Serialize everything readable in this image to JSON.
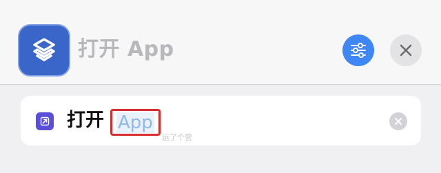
{
  "header": {
    "title": "打开 App",
    "app_icon": "shortcuts-layers-icon",
    "settings_icon": "sliders-icon",
    "close_icon": "close-icon"
  },
  "action": {
    "verb": "打开",
    "parameter_placeholder": "App",
    "action_icon": "open-app-arrow-icon",
    "clear_icon": "clear-x-icon"
  },
  "watermark": "运了个营",
  "colors": {
    "accent_blue": "#3f87f5",
    "app_icon_bg": "#3b66c9",
    "action_icon_bg": "#5a4fd6",
    "highlight_box": "#d62e2e",
    "placeholder_text": "#8fb9ea"
  }
}
